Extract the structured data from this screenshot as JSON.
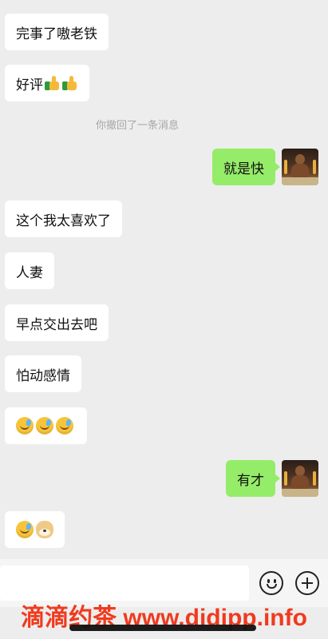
{
  "messages": [
    {
      "side": "left",
      "text": "完事了嗷老铁"
    },
    {
      "side": "left",
      "text": "好评",
      "emojis": [
        "thumbs-up-icon",
        "thumbs-up-icon"
      ]
    },
    {
      "side": "system",
      "text": "你撤回了一条消息"
    },
    {
      "side": "right",
      "text": "就是快"
    },
    {
      "side": "left",
      "text": "这个我太喜欢了"
    },
    {
      "side": "left",
      "text": "人妻"
    },
    {
      "side": "left",
      "text": "早点交出去吧"
    },
    {
      "side": "left",
      "text": "怕动感情"
    },
    {
      "side": "left",
      "emojis": [
        "laughing-crying-face-icon",
        "laughing-crying-face-icon",
        "laughing-crying-face-icon"
      ]
    },
    {
      "side": "right",
      "text": "有才"
    },
    {
      "side": "left",
      "emojis": [
        "laughing-crying-face-icon",
        "doge-icon"
      ]
    }
  ],
  "input": {
    "value": "",
    "placeholder": ""
  },
  "watermark": "滴滴约茶 www.didipp.info",
  "colors": {
    "background": "#ededed",
    "my_bubble": "#95ec69",
    "their_bubble": "#ffffff",
    "watermark": "#f03a1e"
  }
}
